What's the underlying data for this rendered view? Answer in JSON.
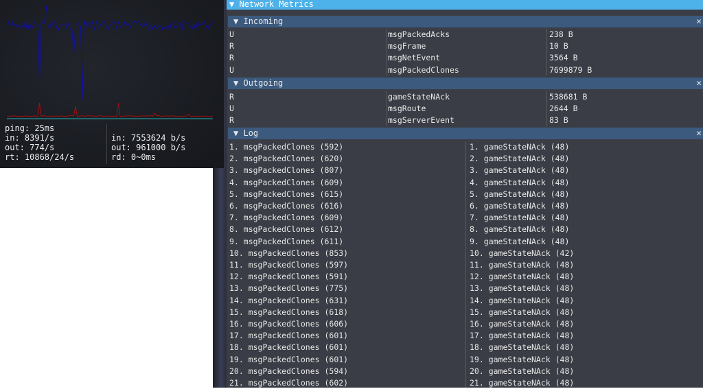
{
  "stats": {
    "ping": "ping: 25ms",
    "in_count": "in: 8391/s",
    "out_count": "out: 774/s",
    "rt": "rt: 10868/24/s",
    "in_rate": "in: 7553624 b/s",
    "out_rate": "out: 961000 b/s",
    "rd": "rd: 0~0ms"
  },
  "colors": {
    "incoming_line": "#1010a0",
    "outgoing_line": "#a01010",
    "baseline": "#20b0b0",
    "title_bar": "#4db1ea",
    "section_header": "#3c5a7e"
  },
  "window": {
    "title": "Network Metrics",
    "collapse_icon": "▼"
  },
  "incoming": {
    "title": "Incoming",
    "close": "✕",
    "rows": [
      {
        "type": "U",
        "name": "msgPackedAcks",
        "size": "238 B"
      },
      {
        "type": "R",
        "name": "msgFrame",
        "size": "10 B"
      },
      {
        "type": "R",
        "name": "msgNetEvent",
        "size": "3564 B"
      },
      {
        "type": "U",
        "name": "msgPackedClones",
        "size": "7699879 B"
      }
    ]
  },
  "outgoing": {
    "title": "Outgoing",
    "close": "✕",
    "rows": [
      {
        "type": "R",
        "name": "gameStateNAck",
        "size": "538681 B"
      },
      {
        "type": "U",
        "name": "msgRoute",
        "size": "2644 B"
      },
      {
        "type": "R",
        "name": "msgServerEvent",
        "size": "83 B"
      }
    ]
  },
  "log": {
    "title": "Log",
    "close": "✕",
    "incoming": [
      "1. msgPackedClones (592)",
      "2. msgPackedClones (620)",
      "3. msgPackedClones (807)",
      "4. msgPackedClones (609)",
      "5. msgPackedClones (615)",
      "6. msgPackedClones (616)",
      "7. msgPackedClones (609)",
      "8. msgPackedClones (612)",
      "9. msgPackedClones (611)",
      "10. msgPackedClones (853)",
      "11. msgPackedClones (597)",
      "12. msgPackedClones (591)",
      "13. msgPackedClones (775)",
      "14. msgPackedClones (631)",
      "15. msgPackedClones (618)",
      "16. msgPackedClones (606)",
      "17. msgPackedClones (601)",
      "18. msgPackedClones (601)",
      "19. msgPackedClones (601)",
      "20. msgPackedClones (594)",
      "21. msgPackedClones (602)"
    ],
    "outgoing": [
      "1. gameStateNAck (48)",
      "2. gameStateNAck (48)",
      "3. gameStateNAck (48)",
      "4. gameStateNAck (48)",
      "5. gameStateNAck (48)",
      "6. gameStateNAck (48)",
      "7. gameStateNAck (48)",
      "8. gameStateNAck (48)",
      "9. gameStateNAck (48)",
      "10. gameStateNAck (42)",
      "11. gameStateNAck (48)",
      "12. gameStateNAck (48)",
      "13. gameStateNAck (48)",
      "14. gameStateNAck (48)",
      "15. gameStateNAck (48)",
      "16. gameStateNAck (48)",
      "17. gameStateNAck (48)",
      "18. gameStateNAck (48)",
      "19. gameStateNAck (48)",
      "20. gameStateNAck (48)",
      "21. gameStateNAck (48)"
    ]
  }
}
